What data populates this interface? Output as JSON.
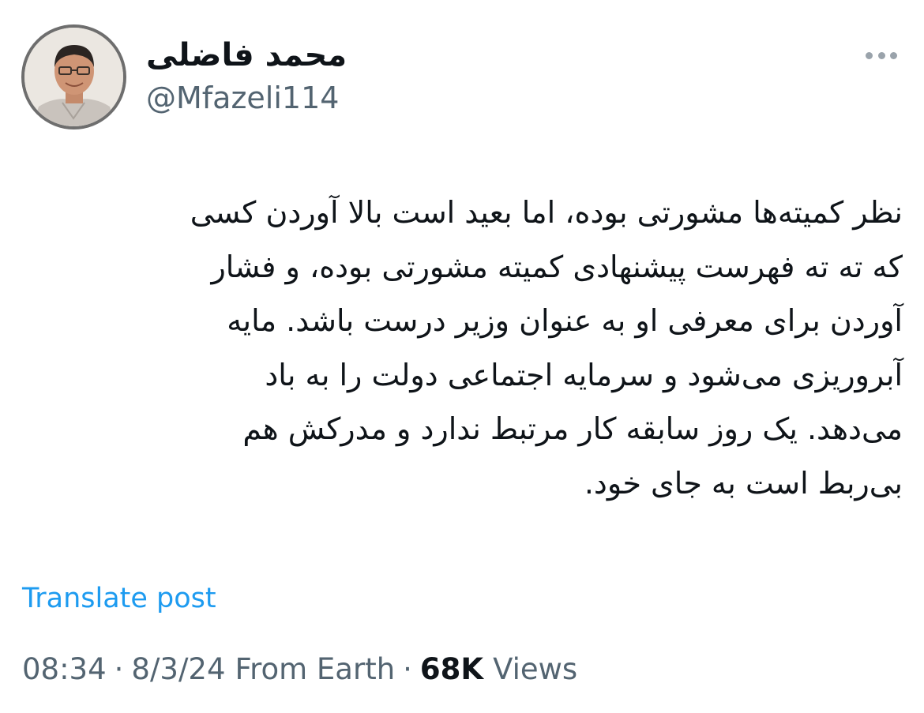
{
  "author": {
    "display_name": "محمد فاضلی",
    "handle": "@Mfazeli114"
  },
  "post": {
    "lines": [
      "نظر کمیته‌ها مشورتی بوده، اما بعید است بالا آوردن کسی",
      "که ته ته فهرست پیشنهادی کمیته مشورتی بوده، و فشار",
      "آوردن برای معرفی او به عنوان وزیر درست باشد. مایه",
      "آبروریزی می‌شود و سرمایه اجتماعی دولت را به باد",
      "می‌دهد. یک روز سابقه کار مرتبط ندارد و مدرکش هم",
      "بی‌ربط است به جای خود."
    ],
    "translate_label": "Translate post"
  },
  "meta": {
    "time": "08:34",
    "separator": "·",
    "date": "8/3/24",
    "source": "From Earth",
    "views_count": "68K",
    "views_label": "Views"
  },
  "icons": {
    "more": "more-horizontal-icon"
  },
  "colors": {
    "link": "#1d9bf0",
    "secondary": "#536471",
    "primary_text": "#0f1419"
  }
}
